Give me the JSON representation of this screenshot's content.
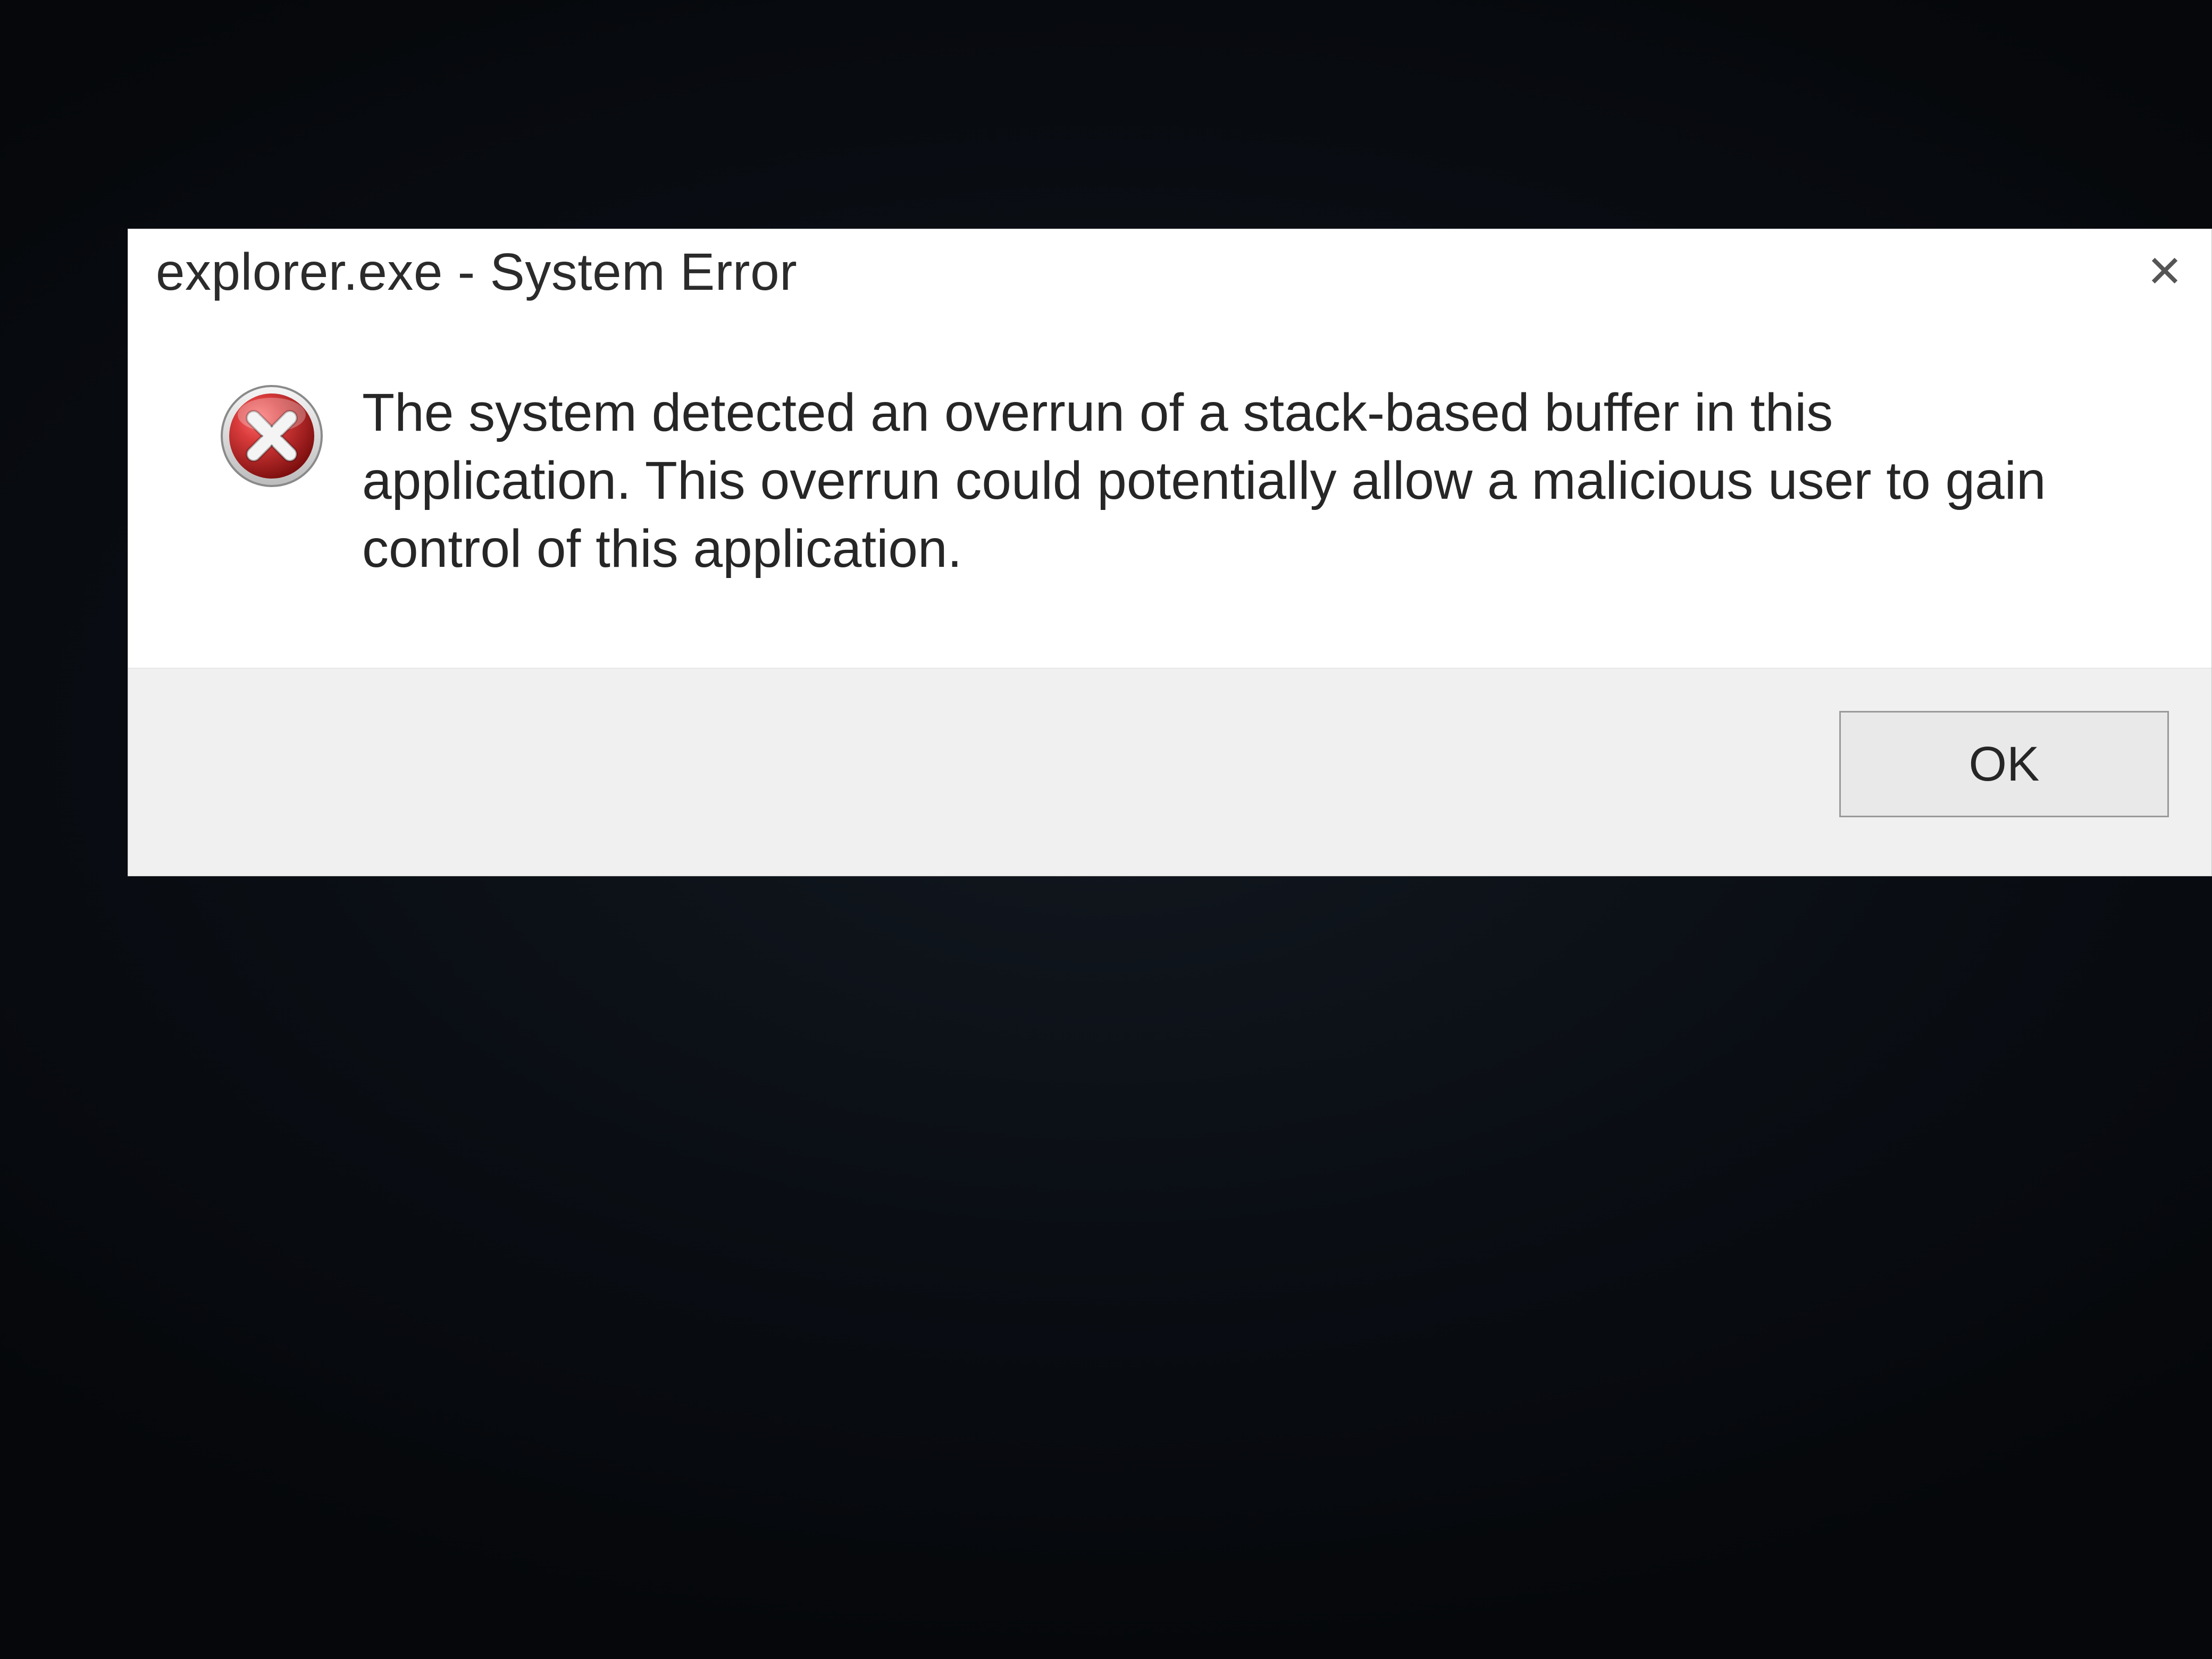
{
  "dialog": {
    "title": "explorer.exe - System Error",
    "close_icon": "close-icon",
    "icon": "error-x-icon",
    "message": "The system detected an overrun of a stack-based buffer in this application. This overrun could potentially allow a malicious user to gain control of this application.",
    "ok_label": "OK"
  }
}
